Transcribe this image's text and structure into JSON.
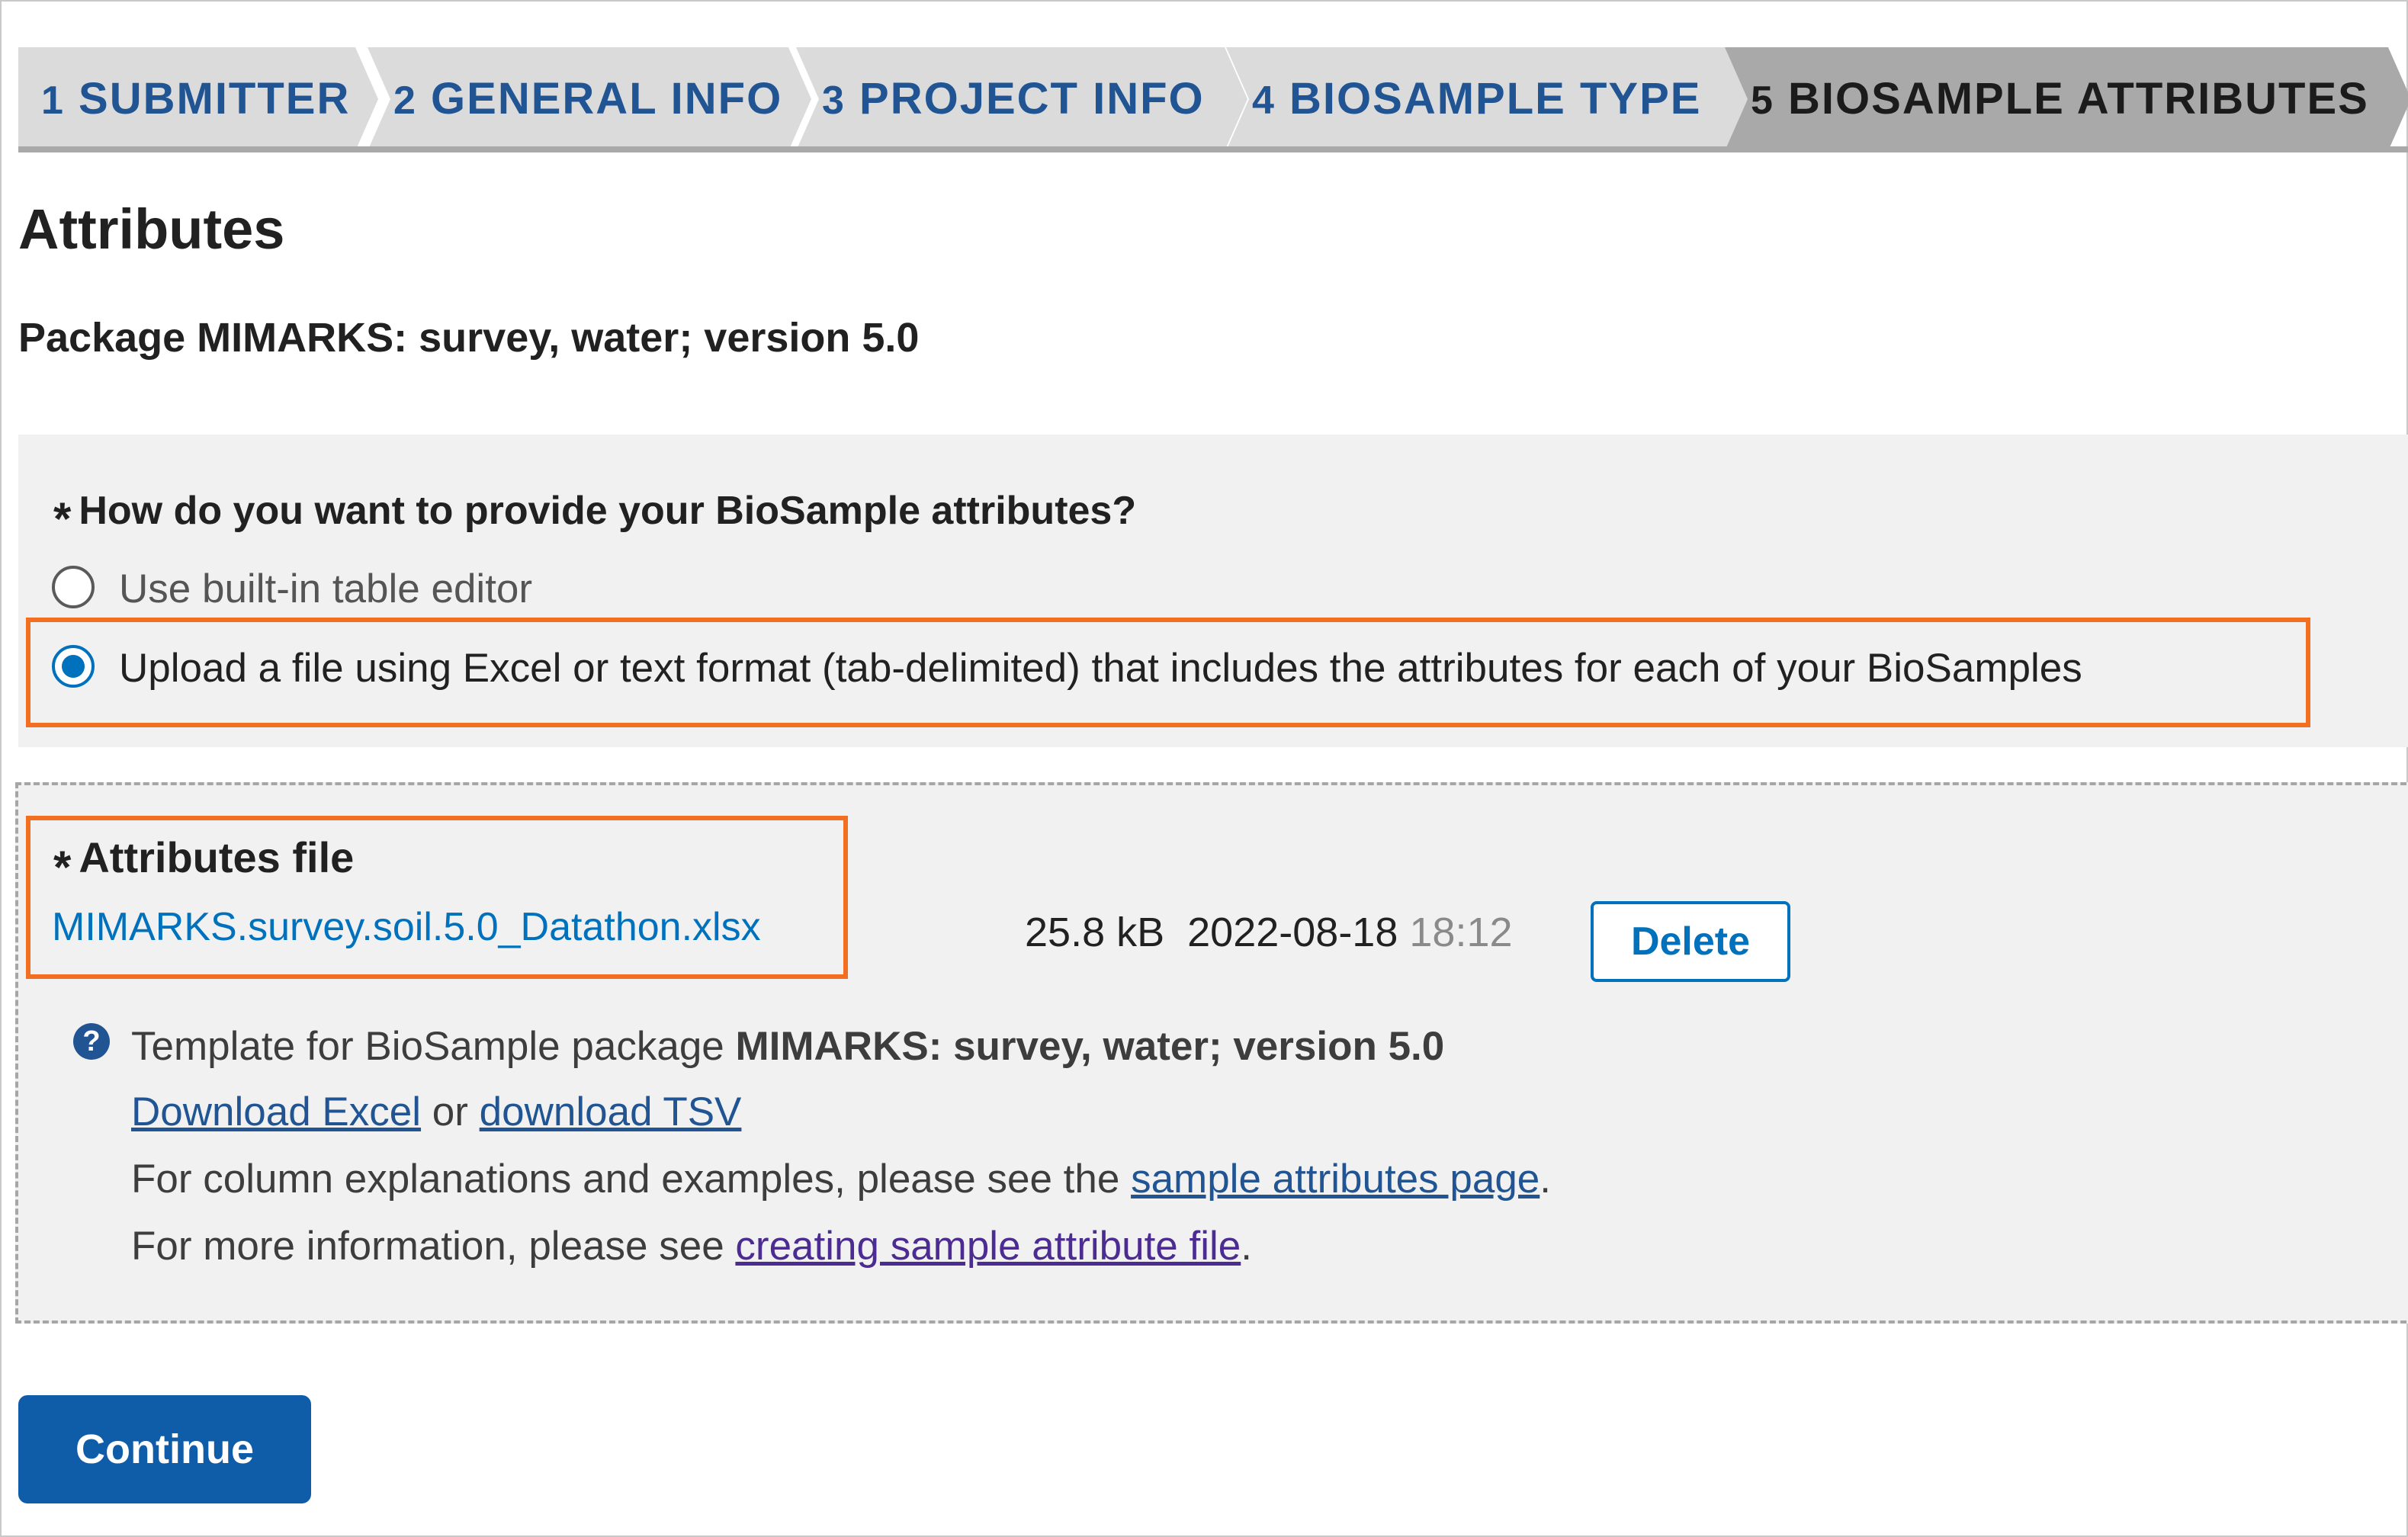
{
  "steps": [
    {
      "num": "1",
      "label": "SUBMITTER"
    },
    {
      "num": "2",
      "label": "GENERAL INFO"
    },
    {
      "num": "3",
      "label": "PROJECT INFO"
    },
    {
      "num": "4",
      "label": "BIOSAMPLE TYPE"
    },
    {
      "num": "5",
      "label": "BIOSAMPLE ATTRIBUTES"
    }
  ],
  "active_step": 5,
  "page": {
    "title": "Attributes",
    "package": "Package MIMARKS: survey, water; version 5.0"
  },
  "question": {
    "required_mark": "*",
    "text": "How do you want to provide your BioSample attributes?",
    "options": [
      {
        "label": "Use built-in table editor",
        "selected": false
      },
      {
        "label": "Upload a file using Excel or text format (tab-delimited) that includes the attributes for each of your BioSamples",
        "selected": true
      }
    ]
  },
  "file": {
    "required_mark": "*",
    "label": "Attributes file",
    "name": "MIMARKS.survey.soil.5.0_Datathon.xlsx",
    "size": "25.8 kB",
    "date": "2022-08-18",
    "time": "18:12",
    "delete_label": "Delete"
  },
  "help": {
    "icon": "question-circle-icon",
    "template_prefix": "Template for BioSample package",
    "template_package": "MIMARKS: survey, water; version 5.0",
    "download_excel": "Download Excel",
    "or": "or",
    "download_tsv": "download TSV",
    "columns_prefix": "For column explanations and examples, please see the",
    "columns_link": "sample attributes page",
    "more_prefix": "For more information, please see",
    "more_link": "creating sample attribute file",
    "period": "."
  },
  "continue_label": "Continue",
  "colors": {
    "highlight": "#f26f21",
    "link": "#0071bc",
    "primary_button": "#0f5ca8",
    "step_inactive": "#dbdbdb",
    "step_active": "#a9a9a9"
  }
}
